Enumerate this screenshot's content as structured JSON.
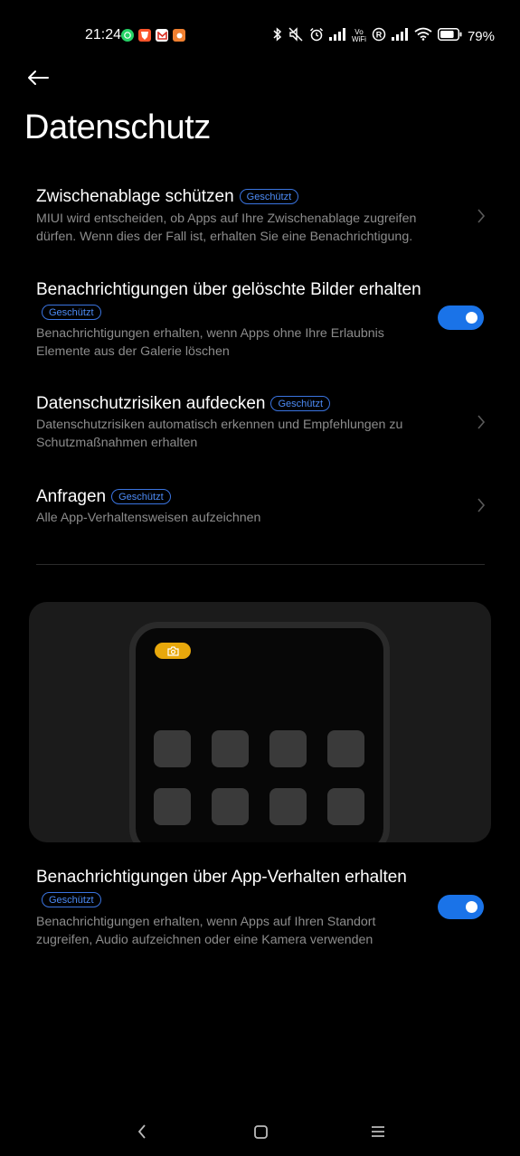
{
  "status_bar": {
    "time": "21:24",
    "notification_icons": [
      "whatsapp-icon",
      "brave-icon",
      "gmail-icon",
      "app-notification-icon"
    ],
    "notification_colors": [
      "#25d366",
      "#fb542b",
      "#ffffff",
      "#f08030"
    ],
    "right_icons": [
      "bluetooth-icon",
      "mute-icon",
      "alarm-icon",
      "signal-icon",
      "vowifi-icon",
      "roaming-icon",
      "signal-icon",
      "wifi-icon",
      "battery-icon"
    ],
    "battery_level": 0.79,
    "battery_percent": "79%"
  },
  "header": {
    "back_icon": "arrow-left-icon",
    "title": "Datenschutz"
  },
  "settings": [
    {
      "title": "Zwischenablage schützen",
      "badge": "Geschützt",
      "description": "MIUI wird entscheiden, ob Apps auf Ihre Zwischenablage zugreifen dürfen. Wenn dies der Fall ist, erhalten Sie eine Benachrichtigung.",
      "control": "chevron"
    },
    {
      "title": "Benachrichtigungen über gelöschte Bilder erhalten",
      "badge": "Geschützt",
      "description": "Benachrichtigungen erhalten, wenn Apps ohne Ihre Erlaubnis Elemente aus der Galerie löschen",
      "control": "toggle",
      "enabled": true
    },
    {
      "title": "Datenschutzrisiken aufdecken",
      "badge": "Geschützt",
      "description": "Datenschutzrisiken automatisch erkennen und Empfehlungen zu Schutzmaßnahmen erhalten",
      "control": "chevron"
    },
    {
      "title": "Anfragen",
      "badge": "Geschützt",
      "description": "Alle App-Verhaltensweisen aufzeichnen",
      "control": "chevron"
    }
  ],
  "illustration": {
    "indicator_icon": "camera-icon",
    "indicator_color": "#e8a80c",
    "app_tile_count": 8
  },
  "app_behavior_setting": {
    "title": "Benachrichtigungen über App-Verhalten erhalten",
    "badge": "Geschützt",
    "description": "Benachrichtigungen erhalten, wenn Apps auf Ihren Standort zugreifen, Audio aufzeichnen oder eine Kamera verwenden",
    "control": "toggle",
    "enabled": true
  },
  "colors": {
    "accent": "#1a73e8",
    "badge": "#4d8bf5",
    "background": "#000000",
    "secondary_text": "#8c8c8c"
  },
  "nav_bar": {
    "icons": [
      "nav-back-icon",
      "nav-home-icon",
      "nav-recents-icon"
    ]
  }
}
